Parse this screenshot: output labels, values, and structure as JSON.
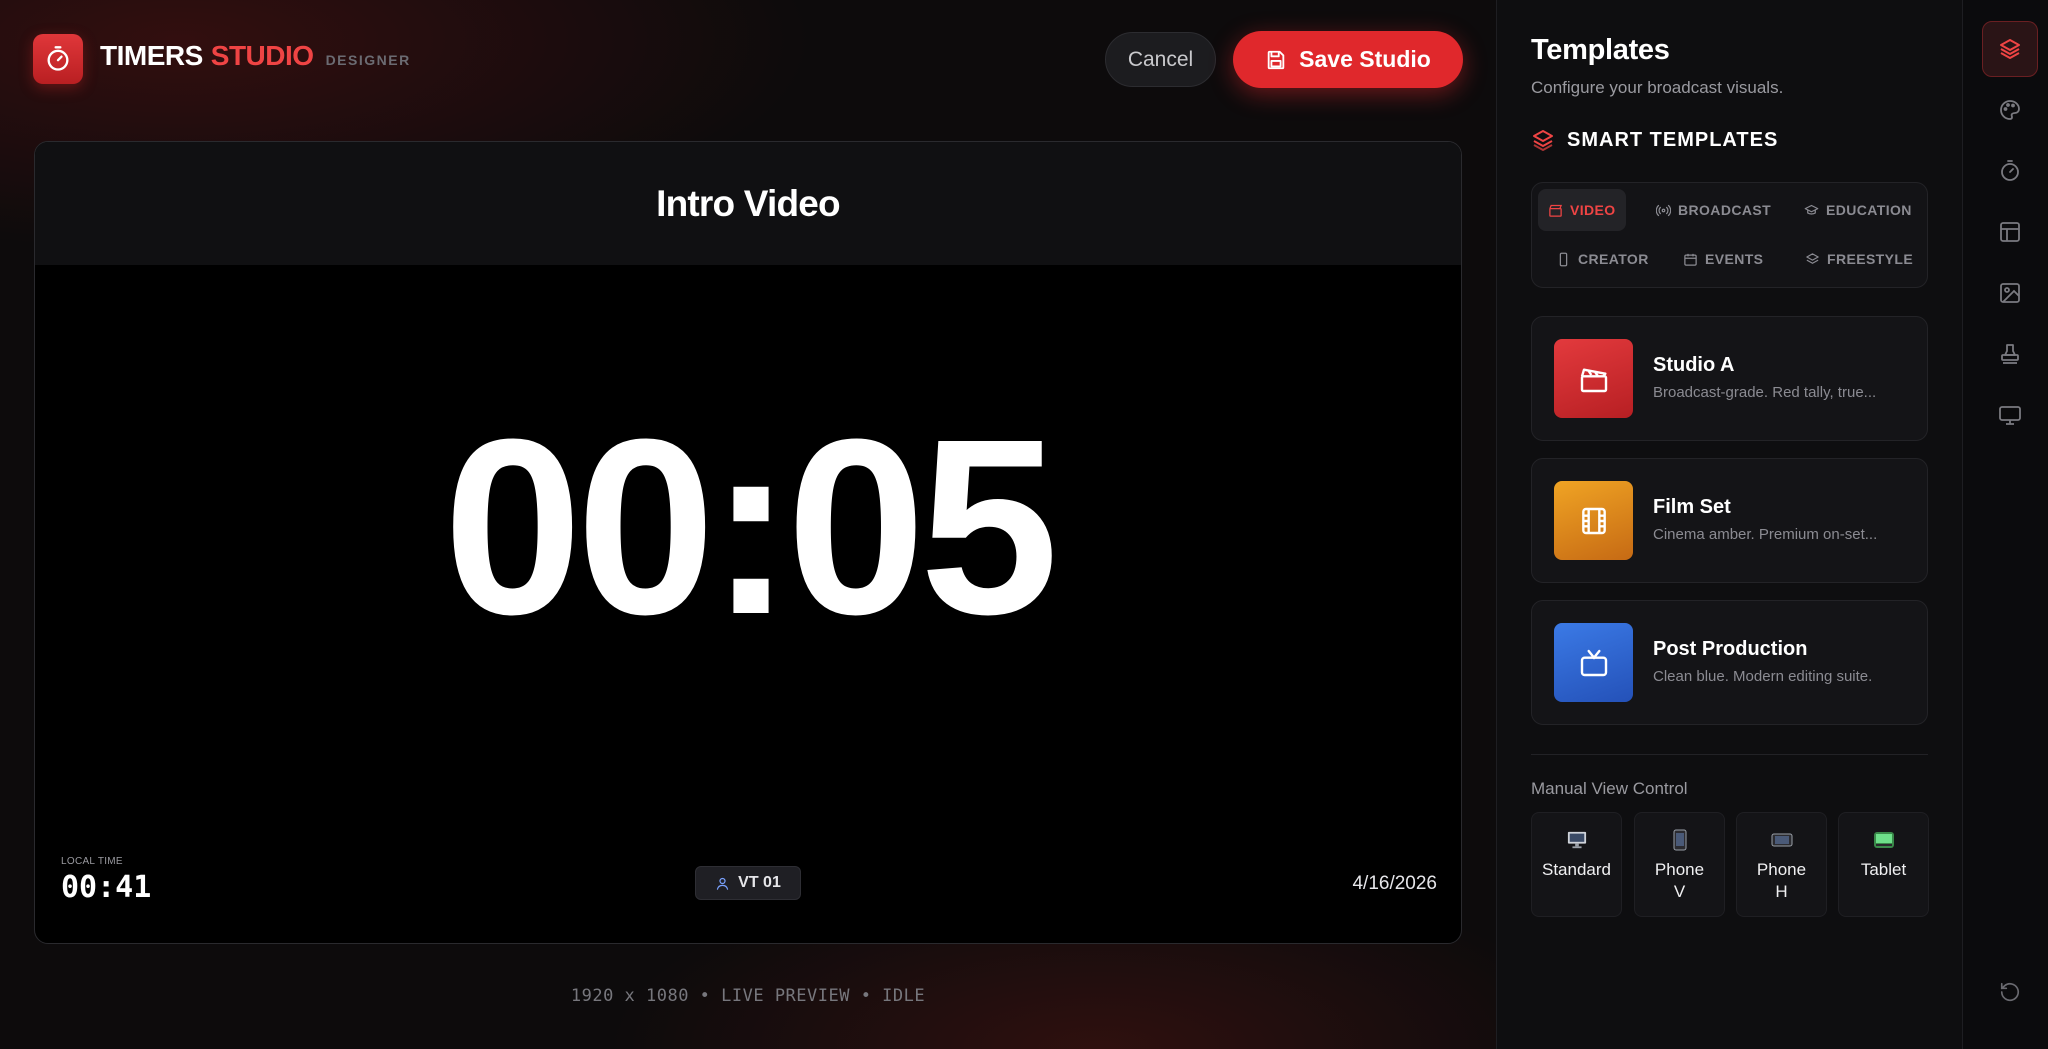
{
  "header": {
    "brand_part1": "TIMERS",
    "brand_part2": "STUDIO",
    "brand_tag": "DESIGNER",
    "cancel_label": "Cancel",
    "save_label": "Save Studio"
  },
  "preview": {
    "title": "Intro Video",
    "timer": "00:05",
    "local_time_label": "LOCAL TIME",
    "local_time": "00:41",
    "badge": "VT 01",
    "date": "4/16/2026"
  },
  "status_line": "1920 x 1080 • LIVE PREVIEW • IDLE",
  "panel": {
    "title": "Templates",
    "subtitle": "Configure your broadcast visuals.",
    "section_title": "SMART TEMPLATES",
    "categories": [
      {
        "label": "VIDEO",
        "icon": "clapper-icon",
        "active": true
      },
      {
        "label": "BROADCAST",
        "icon": "broadcast-icon",
        "active": false
      },
      {
        "label": "EDUCATION",
        "icon": "graduation-cap-icon",
        "active": false
      },
      {
        "label": "CREATOR",
        "icon": "smartphone-icon",
        "active": false
      },
      {
        "label": "EVENTS",
        "icon": "calendar-icon",
        "active": false
      },
      {
        "label": "FREESTYLE",
        "icon": "layers-icon",
        "active": false
      }
    ],
    "templates": [
      {
        "name": "Studio A",
        "desc": "Broadcast-grade. Red tally, true...",
        "icon": "clapper-icon",
        "color": "#d62a2e"
      },
      {
        "name": "Film Set",
        "desc": "Cinema amber. Premium on-set...",
        "icon": "film-icon",
        "color": "#e08a1c"
      },
      {
        "name": "Post Production",
        "desc": "Clean blue. Modern editing suite.",
        "icon": "tv-icon",
        "color": "#2f6ad8"
      }
    ],
    "manual_view_label": "Manual View Control",
    "views": [
      {
        "label": "Standard",
        "icon": "desktop-icon"
      },
      {
        "label": "Phone V",
        "icon": "phone-vertical-icon"
      },
      {
        "label": "Phone H",
        "icon": "phone-horizontal-icon"
      },
      {
        "label": "Tablet",
        "icon": "tablet-icon"
      }
    ]
  },
  "rail": {
    "items": [
      "layers-icon",
      "palette-icon",
      "timer-icon",
      "layout-icon",
      "image-icon",
      "stamp-icon",
      "monitor-icon"
    ],
    "bottom": "reset-icon"
  },
  "colors": {
    "accent": "#e0282c",
    "accent_text": "#ef4444",
    "background": "#0b0b0d"
  }
}
